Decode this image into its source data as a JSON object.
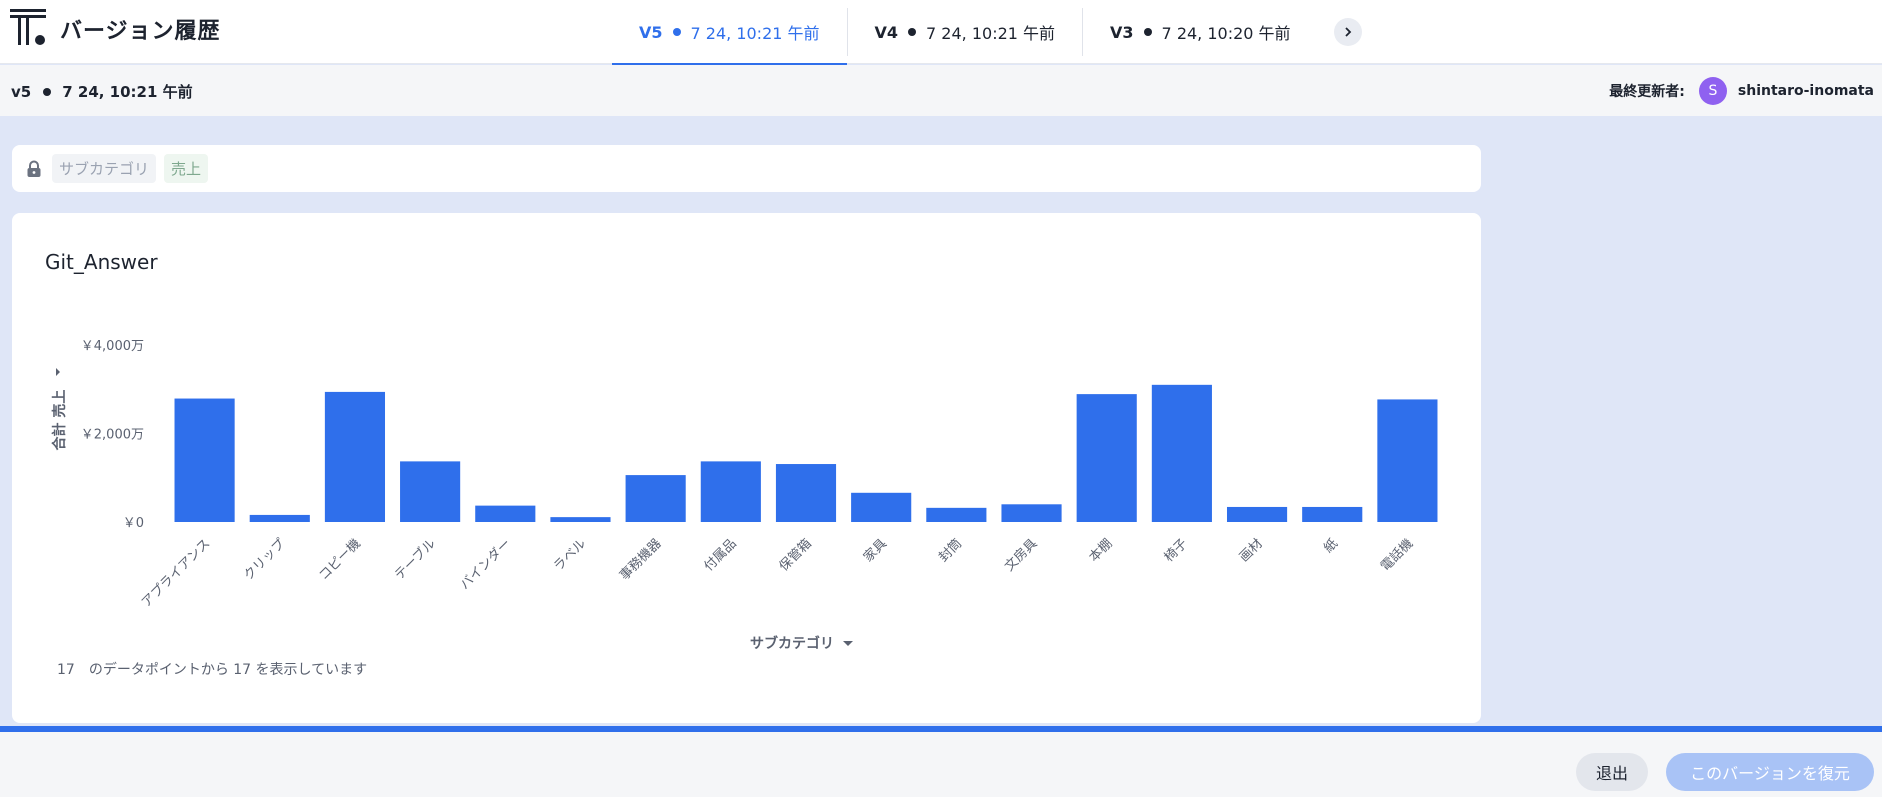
{
  "header": {
    "app_title": "バージョン履歴",
    "tabs": [
      {
        "version": "V5",
        "timestamp": "7 24, 10:21 午前",
        "active": true
      },
      {
        "version": "V4",
        "timestamp": "7 24, 10:21 午前",
        "active": false
      },
      {
        "version": "V3",
        "timestamp": "7 24, 10:20 午前",
        "active": false
      }
    ],
    "next_icon": "chevron-right-icon"
  },
  "info_bar": {
    "version": "v5",
    "timestamp": "7 24, 10:21 午前",
    "updated_by_label": "最終更新者:",
    "avatar_initial": "S",
    "username": "shintaro-inomata"
  },
  "search": {
    "lock_icon": "lock-icon",
    "tokens": [
      "サブカテゴリ",
      "売上"
    ]
  },
  "chart": {
    "footnote": "17　のデータポイントから 17 を表示しています"
  },
  "chart_data": {
    "type": "bar",
    "title": "Git_Answer",
    "xlabel": "サブカテゴリ",
    "ylabel": "合計 売上",
    "ylim": [
      0,
      40000000
    ],
    "ytick_labels": [
      "￥0",
      "￥2,000万",
      "￥4,000万"
    ],
    "yticks": [
      0,
      20000000,
      40000000
    ],
    "categories": [
      "アプライアンス",
      "クリップ",
      "コピー機",
      "テーブル",
      "バインダー",
      "ラベル",
      "事務機器",
      "付属品",
      "保管箱",
      "家具",
      "封筒",
      "文房具",
      "本棚",
      "椅子",
      "画材",
      "紙",
      "電話機"
    ],
    "values": [
      27900000,
      1600000,
      29400000,
      13700000,
      3700000,
      1100000,
      10600000,
      13700000,
      13100000,
      6600000,
      3200000,
      4000000,
      28900000,
      31000000,
      3400000,
      3400000,
      27700000
    ],
    "color": "#2f6feb",
    "grid": false
  },
  "footer": {
    "exit_label": "退出",
    "restore_label": "このバージョンを復元"
  }
}
